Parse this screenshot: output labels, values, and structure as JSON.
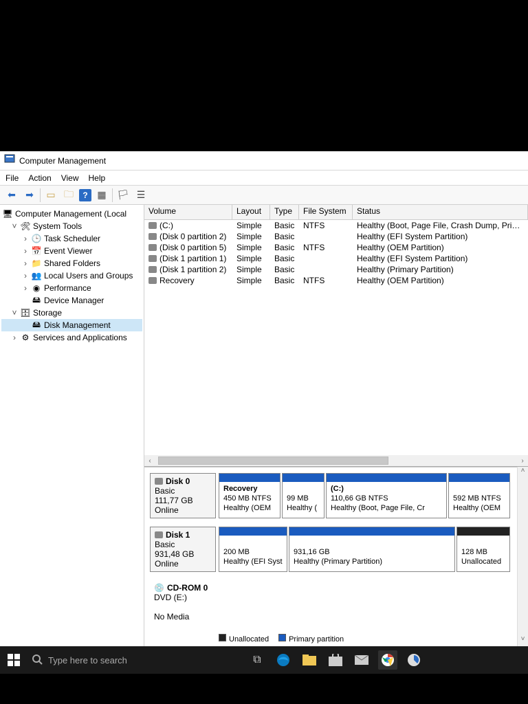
{
  "window": {
    "title": "Computer Management"
  },
  "menubar": [
    "File",
    "Action",
    "View",
    "Help"
  ],
  "tree": {
    "root": "Computer Management (Local",
    "systools": "System Tools",
    "items_systools": [
      "Task Scheduler",
      "Event Viewer",
      "Shared Folders",
      "Local Users and Groups",
      "Performance",
      "Device Manager"
    ],
    "storage": "Storage",
    "diskmgmt": "Disk Management",
    "services": "Services and Applications"
  },
  "grid": {
    "headers": {
      "volume": "Volume",
      "layout": "Layout",
      "type": "Type",
      "fs": "File System",
      "status": "Status"
    },
    "rows": [
      {
        "vol": "(C:)",
        "layout": "Simple",
        "type": "Basic",
        "fs": "NTFS",
        "status": "Healthy (Boot, Page File, Crash Dump, Primary Partition)"
      },
      {
        "vol": "(Disk 0 partition 2)",
        "layout": "Simple",
        "type": "Basic",
        "fs": "",
        "status": "Healthy (EFI System Partition)"
      },
      {
        "vol": "(Disk 0 partition 5)",
        "layout": "Simple",
        "type": "Basic",
        "fs": "NTFS",
        "status": "Healthy (OEM Partition)"
      },
      {
        "vol": "(Disk 1 partition 1)",
        "layout": "Simple",
        "type": "Basic",
        "fs": "",
        "status": "Healthy (EFI System Partition)"
      },
      {
        "vol": "(Disk 1 partition 2)",
        "layout": "Simple",
        "type": "Basic",
        "fs": "",
        "status": "Healthy (Primary Partition)"
      },
      {
        "vol": "Recovery",
        "layout": "Simple",
        "type": "Basic",
        "fs": "NTFS",
        "status": "Healthy (OEM Partition)"
      }
    ]
  },
  "disks": {
    "d0": {
      "name": "Disk 0",
      "type": "Basic",
      "size": "111,77 GB",
      "state": "Online",
      "parts": [
        {
          "title": "Recovery",
          "l2": "450 MB NTFS",
          "l3": "Healthy (OEM"
        },
        {
          "title": "",
          "l2": "99 MB",
          "l3": "Healthy ("
        },
        {
          "title": "(C:)",
          "l2": "110,66 GB NTFS",
          "l3": "Healthy (Boot, Page File, Cr"
        },
        {
          "title": "",
          "l2": "592 MB NTFS",
          "l3": "Healthy (OEM"
        }
      ]
    },
    "d1": {
      "name": "Disk 1",
      "type": "Basic",
      "size": "931,48 GB",
      "state": "Online",
      "parts": [
        {
          "title": "",
          "l2": "200 MB",
          "l3": "Healthy (EFI Syst"
        },
        {
          "title": "",
          "l2": "931,16 GB",
          "l3": "Healthy (Primary Partition)"
        },
        {
          "title": "",
          "l2": "128 MB",
          "l3": "Unallocated",
          "unalloc": true
        }
      ]
    },
    "cd": {
      "name": "CD-ROM 0",
      "type": "DVD (E:)",
      "state": "No Media"
    }
  },
  "legend": {
    "unalloc": "Unallocated",
    "primary": "Primary partition"
  },
  "taskbar": {
    "search_placeholder": "Type here to search"
  }
}
